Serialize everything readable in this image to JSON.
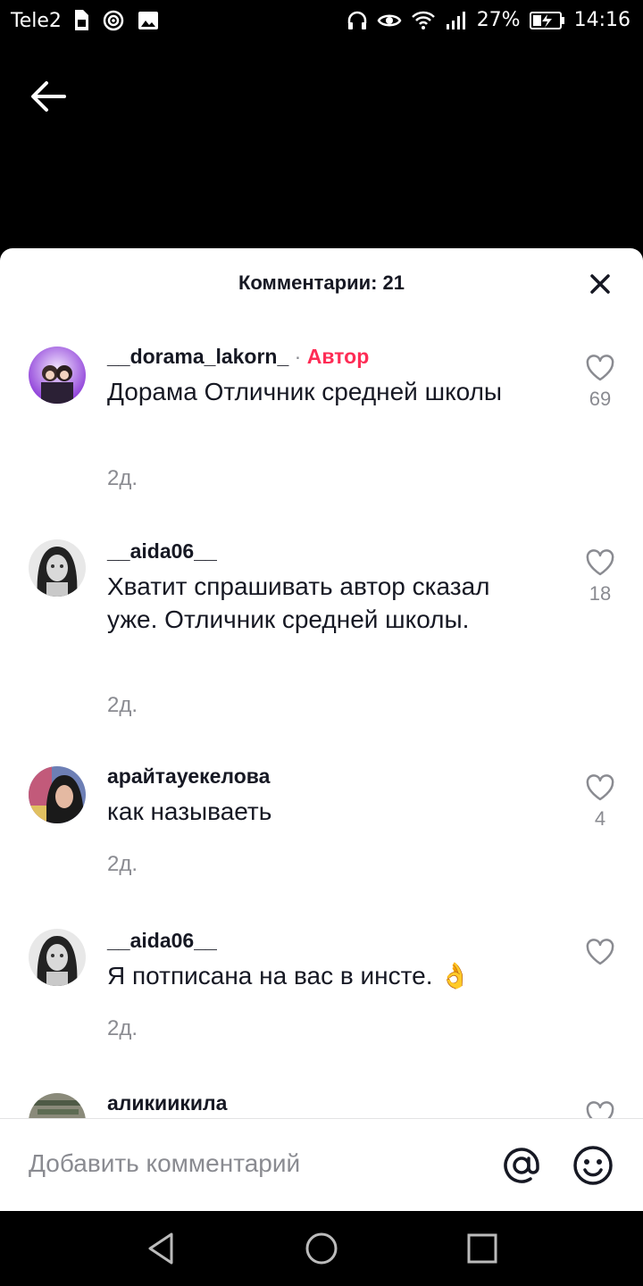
{
  "status": {
    "carrier": "Tele2",
    "battery": "27%",
    "time": "14:16"
  },
  "sheet": {
    "title": "Комментарии: 21"
  },
  "comments": [
    {
      "username": "__dorama_lakorn_",
      "badge": "Автор",
      "separator": "·",
      "text": "Дорама Отличник средней школы",
      "time": "2д.",
      "likes": "69"
    },
    {
      "username": "__aida06__",
      "text": "Хватит спрашивать автор сказал уже. Отличник средней школы.",
      "time": "2д.",
      "likes": "18"
    },
    {
      "username": "арайтауекелова",
      "text": "как называеть",
      "time": "2д.",
      "likes": "4"
    },
    {
      "username": "__aida06__",
      "text": "Я потписана на вас в инсте. 👌",
      "time": "2д.",
      "likes": ""
    },
    {
      "username": "аликиикила"
    }
  ],
  "bottom": {
    "placeholder": "Добавить комментарий"
  },
  "icons": {
    "back": "arrow-left-icon",
    "close": "close-icon",
    "like": "heart-outline-icon",
    "mention": "at-sign-icon",
    "emoji": "smiley-icon"
  },
  "colors": {
    "author_badge": "#fe2c55",
    "secondary_text": "#8a8b91",
    "sheet_bg": "#ffffff",
    "page_bg": "#000000"
  }
}
